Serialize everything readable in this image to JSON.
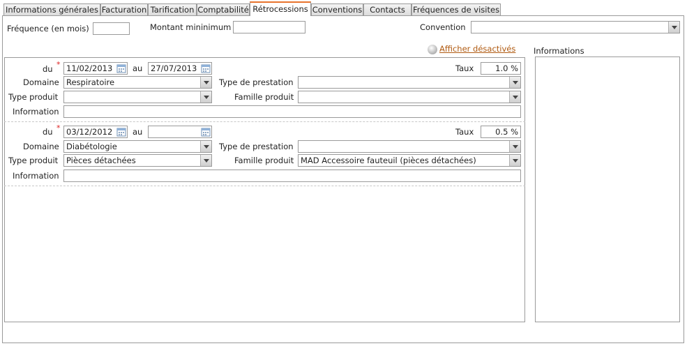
{
  "tabs": [
    {
      "label": "Informations générales"
    },
    {
      "label": "Facturation"
    },
    {
      "label": "Tarification"
    },
    {
      "label": "Comptabilité"
    },
    {
      "label": "Rétrocessions",
      "active": true
    },
    {
      "label": "Conventions"
    },
    {
      "label": "Contacts"
    },
    {
      "label": "Fréquences de visites"
    }
  ],
  "header": {
    "frequence_label": "Fréquence (en mois)",
    "frequence_value": "",
    "montant_label": "Montant mininimum",
    "montant_value": "",
    "convention_label": "Convention",
    "convention_value": ""
  },
  "toggle": {
    "label": "Afficher désactivés",
    "icon": "bulb-icon"
  },
  "info_panel": {
    "label": "Informations",
    "value": ""
  },
  "retrocessions": [
    {
      "du_label": "du",
      "du_value": "11/02/2013",
      "au_label": "au",
      "au_value": "27/07/2013",
      "taux_label": "Taux",
      "taux_value": "1.0 %",
      "domaine_label": "Domaine",
      "domaine_value": "Respiratoire",
      "type_prestation_label": "Type de prestation",
      "type_prestation_value": "",
      "type_produit_label": "Type produit",
      "type_produit_value": "",
      "famille_label": "Famille produit",
      "famille_value": "",
      "information_label": "Information",
      "information_value": ""
    },
    {
      "du_label": "du",
      "du_value": "03/12/2012",
      "au_label": "au",
      "au_value": "",
      "taux_label": "Taux",
      "taux_value": "0.5 %",
      "domaine_label": "Domaine",
      "domaine_value": "Diabétologie",
      "type_prestation_label": "Type de prestation",
      "type_prestation_value": "",
      "type_produit_label": "Type produit",
      "type_produit_value": "Pièces détachées",
      "famille_label": "Famille produit",
      "famille_value": "MAD Accessoire fauteuil (pièces détachées)",
      "information_label": "Information",
      "information_value": ""
    }
  ],
  "required_marker": "*",
  "colors": {
    "active_tab_accent": "#e8732c",
    "link": "#b05a10",
    "required": "#dd2222"
  }
}
